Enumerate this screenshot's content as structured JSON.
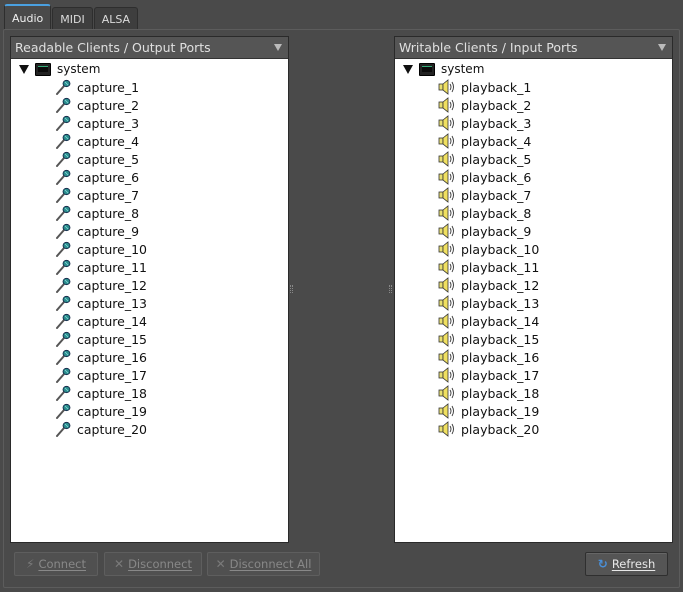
{
  "tabs": [
    {
      "label": "Audio",
      "active": true
    },
    {
      "label": "MIDI",
      "active": false
    },
    {
      "label": "ALSA",
      "active": false
    }
  ],
  "left_panel": {
    "header": "Readable Clients / Output Ports",
    "client": "system",
    "port_icon": "microphone-icon",
    "ports": [
      "capture_1",
      "capture_2",
      "capture_3",
      "capture_4",
      "capture_5",
      "capture_6",
      "capture_7",
      "capture_8",
      "capture_9",
      "capture_10",
      "capture_11",
      "capture_12",
      "capture_13",
      "capture_14",
      "capture_15",
      "capture_16",
      "capture_17",
      "capture_18",
      "capture_19",
      "capture_20"
    ]
  },
  "right_panel": {
    "header": "Writable Clients / Input Ports",
    "client": "system",
    "port_icon": "speaker-icon",
    "ports": [
      "playback_1",
      "playback_2",
      "playback_3",
      "playback_4",
      "playback_5",
      "playback_6",
      "playback_7",
      "playback_8",
      "playback_9",
      "playback_10",
      "playback_11",
      "playback_12",
      "playback_13",
      "playback_14",
      "playback_15",
      "playback_16",
      "playback_17",
      "playback_18",
      "playback_19",
      "playback_20"
    ]
  },
  "buttons": {
    "connect": "Connect",
    "disconnect": "Disconnect",
    "disconnect_all": "Disconnect All",
    "refresh": "Refresh"
  },
  "colors": {
    "accent": "#4aa0e0",
    "window_bg": "#4a4a4a",
    "list_bg": "#ffffff"
  }
}
